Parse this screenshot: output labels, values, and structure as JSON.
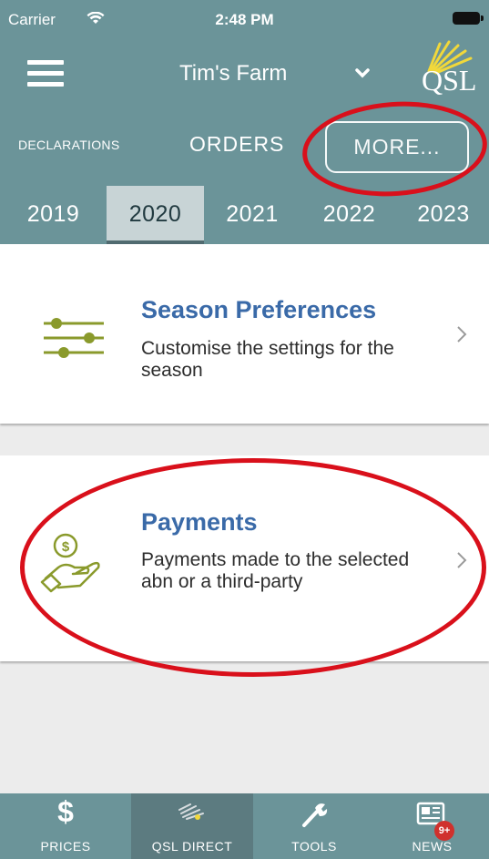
{
  "status_bar": {
    "carrier": "Carrier",
    "time": "2:48 PM"
  },
  "header": {
    "farm_name": "Tim's Farm",
    "logo_text": "QSL"
  },
  "nav_tabs": {
    "declarations": "DECLARATIONS",
    "orders": "ORDERS",
    "more": "MORE..."
  },
  "years": [
    "2019",
    "2020",
    "2021",
    "2022",
    "2023"
  ],
  "selected_year": "2020",
  "cards": {
    "season_preferences": {
      "title": "Season Preferences",
      "description": "Customise the settings for the season"
    },
    "payments": {
      "title": "Payments",
      "description": "Payments made to the selected abn or a third-party"
    }
  },
  "tabbar": {
    "items": [
      {
        "label": "PRICES",
        "icon": "dollar-icon"
      },
      {
        "label": "QSL DIRECT",
        "icon": "qsl-direct-icon"
      },
      {
        "label": "TOOLS",
        "icon": "wrench-icon"
      },
      {
        "label": "NEWS",
        "icon": "newspaper-icon"
      }
    ],
    "active": "QSL DIRECT",
    "news_badge": "9+"
  },
  "colors": {
    "header_bg": "#6b9499",
    "title_blue": "#3a6aa8",
    "icon_olive": "#8a9a2c",
    "annotation_red": "#d9101b"
  }
}
